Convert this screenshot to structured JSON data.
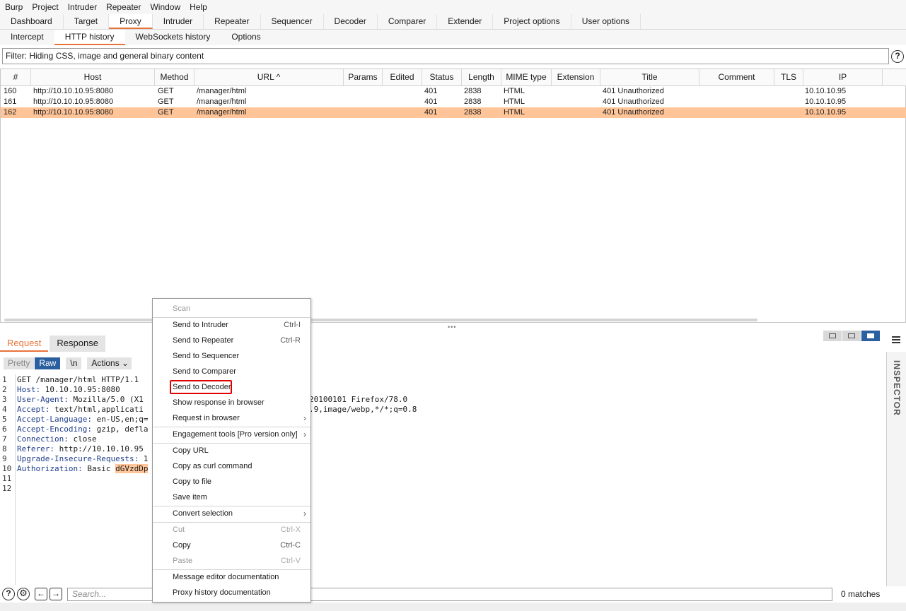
{
  "menubar": [
    "Burp",
    "Project",
    "Intruder",
    "Repeater",
    "Window",
    "Help"
  ],
  "main_tabs": [
    "Dashboard",
    "Target",
    "Proxy",
    "Intruder",
    "Repeater",
    "Sequencer",
    "Decoder",
    "Comparer",
    "Extender",
    "Project options",
    "User options"
  ],
  "sub_tabs": [
    "Intercept",
    "HTTP history",
    "WebSockets history",
    "Options"
  ],
  "filter": "Filter: Hiding CSS, image and general binary content",
  "help_glyph": "?",
  "table": {
    "columns": [
      "#",
      "Host",
      "Method",
      "URL ^",
      "Params",
      "Edited",
      "Status",
      "Length",
      "MIME type",
      "Extension",
      "Title",
      "Comment",
      "TLS",
      "IP"
    ],
    "rows": [
      {
        "num": "160",
        "host": "http://10.10.10.95:8080",
        "method": "GET",
        "url": "/manager/html",
        "status": "401",
        "length": "2838",
        "mime": "HTML",
        "title": "401 Unauthorized",
        "ip": "10.10.10.95"
      },
      {
        "num": "161",
        "host": "http://10.10.10.95:8080",
        "method": "GET",
        "url": "/manager/html",
        "status": "401",
        "length": "2838",
        "mime": "HTML",
        "title": "401 Unauthorized",
        "ip": "10.10.10.95"
      },
      {
        "num": "162",
        "host": "http://10.10.10.95:8080",
        "method": "GET",
        "url": "/manager/html",
        "status": "401",
        "length": "2838",
        "mime": "HTML",
        "title": "401 Unauthorized",
        "ip": "10.10.10.95"
      }
    ]
  },
  "splitter": "•••",
  "message_tabs": [
    "Request",
    "Response"
  ],
  "editor_toolbar": {
    "pretty": "Pretty",
    "raw": "Raw",
    "newline": "\\n",
    "actions": "Actions ⌄"
  },
  "editor": {
    "lines": [
      {
        "n": "1",
        "key": "",
        "val": "GET /manager/html HTTP/1.1"
      },
      {
        "n": "2",
        "key": "Host:",
        "val": " 10.10.10.95:8080"
      },
      {
        "n": "3",
        "key": "User-Agent:",
        "val": " Mozilla/5.0 (X1"
      },
      {
        "n": "4",
        "key": "Accept:",
        "val": " text/html,applicati"
      },
      {
        "n": "5",
        "key": "Accept-Language:",
        "val": " en-US,en;q="
      },
      {
        "n": "6",
        "key": "Accept-Encoding:",
        "val": " gzip, defla"
      },
      {
        "n": "7",
        "key": "Connection:",
        "val": " close"
      },
      {
        "n": "8",
        "key": "Referer:",
        "val": " http://10.10.10.95"
      },
      {
        "n": "9",
        "key": "Upgrade-Insecure-Requests:",
        "val": " 1"
      },
      {
        "n": "10",
        "key": "Authorization:",
        "val": " Basic "
      },
      {
        "n": "11",
        "key": "",
        "val": ""
      },
      {
        "n": "12",
        "key": "",
        "val": ""
      }
    ],
    "auth_highlight": "dGVzdDp",
    "line3_tail": "20100101 Firefox/78.0",
    "line4_tail": ".9,image/webp,*/*;q=0.8"
  },
  "inspector_label": "INSPECTOR",
  "search": {
    "placeholder": "Search...",
    "matches": "0 matches"
  },
  "bottom_icons": {
    "help": "?",
    "settings": "⚙",
    "back": "←",
    "forward": "→"
  },
  "context_menu": {
    "items": [
      {
        "label": "Scan",
        "shortcut": "",
        "disabled": true
      },
      {
        "label": "Send to Intruder",
        "shortcut": "Ctrl-I"
      },
      {
        "label": "Send to Repeater",
        "shortcut": "Ctrl-R"
      },
      {
        "label": "Send to Sequencer",
        "shortcut": ""
      },
      {
        "label": "Send to Comparer",
        "shortcut": ""
      },
      {
        "label": "Send to Decoder",
        "shortcut": "",
        "highlighted": true
      },
      {
        "label": "Show response in browser",
        "shortcut": ""
      },
      {
        "label": "Request in browser",
        "shortcut": "",
        "submenu": true
      },
      {
        "label": "Engagement tools [Pro version only]",
        "shortcut": "",
        "submenu": true
      },
      {
        "label": "Copy URL",
        "shortcut": ""
      },
      {
        "label": "Copy as curl command",
        "shortcut": ""
      },
      {
        "label": "Copy to file",
        "shortcut": ""
      },
      {
        "label": "Save item",
        "shortcut": ""
      },
      {
        "label": "Convert selection",
        "shortcut": "",
        "submenu": true
      },
      {
        "label": "Cut",
        "shortcut": "Ctrl-X",
        "disabled": true
      },
      {
        "label": "Copy",
        "shortcut": "Ctrl-C"
      },
      {
        "label": "Paste",
        "shortcut": "Ctrl-V",
        "disabled": true
      },
      {
        "label": "Message editor documentation",
        "shortcut": ""
      },
      {
        "label": "Proxy history documentation",
        "shortcut": ""
      }
    ],
    "submenu_arrow": "›"
  },
  "colors": {
    "accent": "#e8733a",
    "selected_row": "#ffc599",
    "toggle_active": "#2a5fa0",
    "highlight_box": "#e00000"
  }
}
